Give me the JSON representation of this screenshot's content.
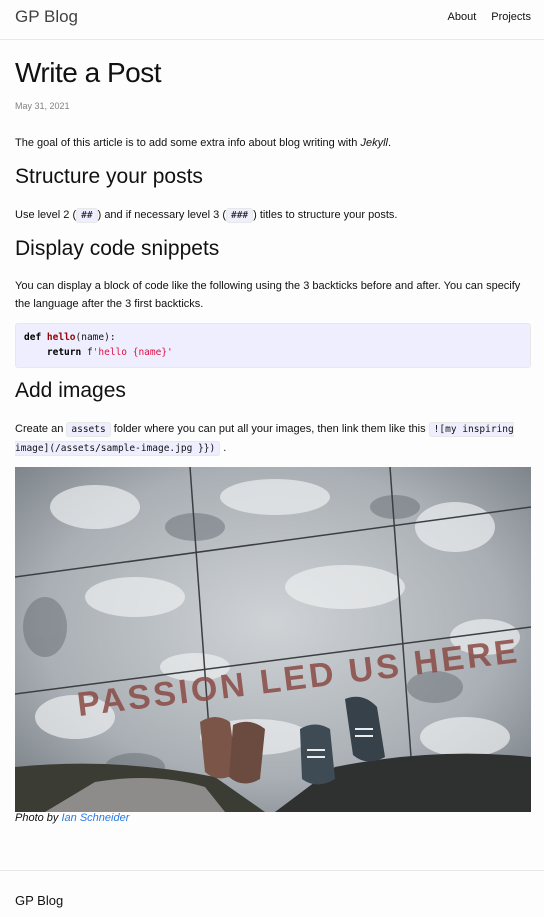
{
  "header": {
    "site_title": "GP Blog",
    "nav": [
      "About",
      "Projects"
    ]
  },
  "post": {
    "title": "Write a Post",
    "date": "May 31, 2021",
    "intro_prefix": "The goal of this article is to add some extra info about blog writing with ",
    "intro_em": "Jekyll",
    "intro_suffix": ".",
    "sections": [
      {
        "heading": "Structure your posts",
        "text_1": "Use level 2 (",
        "code_1": "##",
        "text_2": ") and if necessary level 3 (",
        "code_2": "###",
        "text_3": ") titles to structure your posts."
      },
      {
        "heading": "Display code snippets",
        "text": "You can display a block of code like the following using the 3 backticks before and after. You can specify the language after the 3 first backticks.",
        "code_lines": {
          "kw_def": "def",
          "fn_name": "hello",
          "params": "(name):",
          "kw_return": "return",
          "prefix": "f",
          "string": "'hello {name}'"
        }
      },
      {
        "heading": "Add images",
        "text_1": "Create an",
        "code_1": "assets",
        "text_2": "folder where you can put all your images, then link them like this",
        "code_2": "![my inspiring image](/assets/sample-image.jpg }})",
        "text_3": "."
      }
    ],
    "image": {
      "overlay_text": "PASSION LED US HERE",
      "caption_prefix": "Photo by",
      "caption_link": "Ian Schneider"
    }
  },
  "footer": {
    "title": "GP Blog"
  }
}
